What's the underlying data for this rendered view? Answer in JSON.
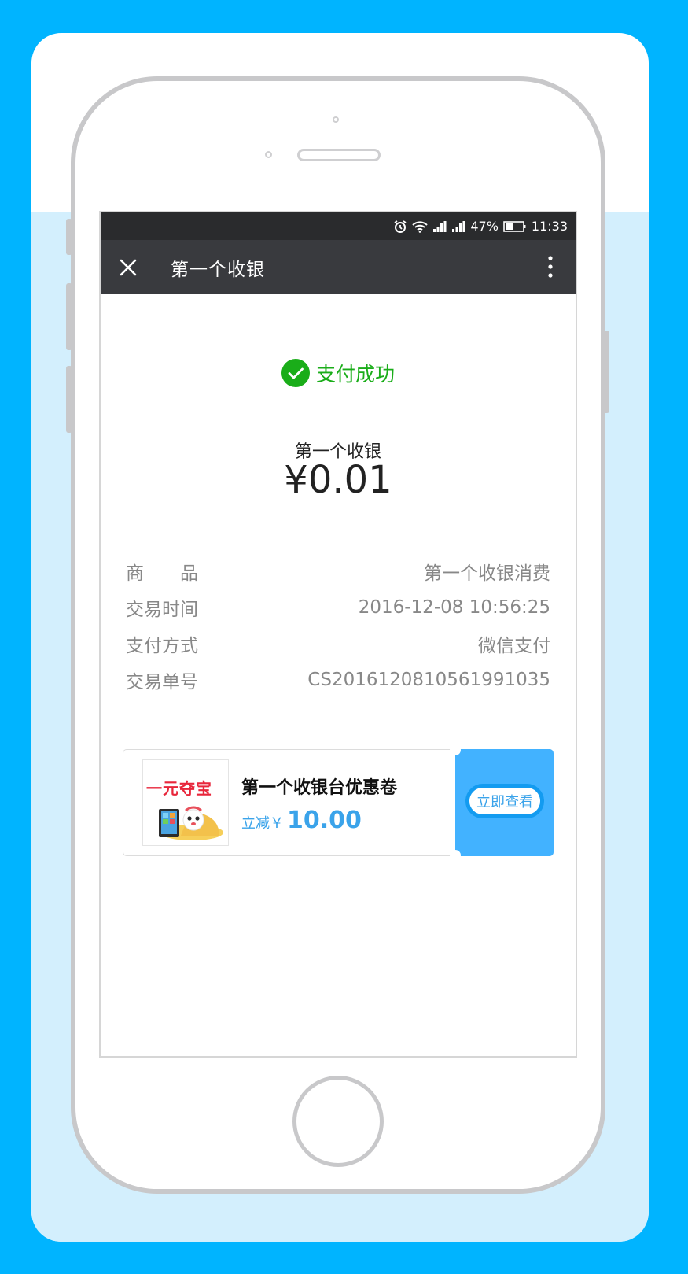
{
  "colors": {
    "page_bg": "#00b4ff",
    "success_green": "#1aad19",
    "coupon_blue": "#42b2ff",
    "navbar": "#393a3e"
  },
  "statusbar": {
    "battery": "47%",
    "time": "11:33",
    "icons": [
      "alarm-icon",
      "wifi-icon",
      "signal-icon",
      "signal-icon",
      "battery-icon"
    ]
  },
  "navbar": {
    "title": "第一个收银",
    "close_icon": "close-icon",
    "more_icon": "more-vertical-icon"
  },
  "result": {
    "status": "支付成功",
    "merchant": "第一个收银",
    "amount": "¥0.01"
  },
  "details": [
    {
      "label": "商　　品",
      "value": "第一个收银消费"
    },
    {
      "label": "交易时间",
      "value": "2016-12-08 10:56:25"
    },
    {
      "label": "支付方式",
      "value": "微信支付"
    },
    {
      "label": "交易单号",
      "value": "CS2016120810561991035"
    }
  ],
  "coupon": {
    "thumb_title": "一元夺宝",
    "title": "第一个收银台优惠卷",
    "discount_label": "立减￥",
    "discount_value": "10.00",
    "button": "立即查看"
  }
}
